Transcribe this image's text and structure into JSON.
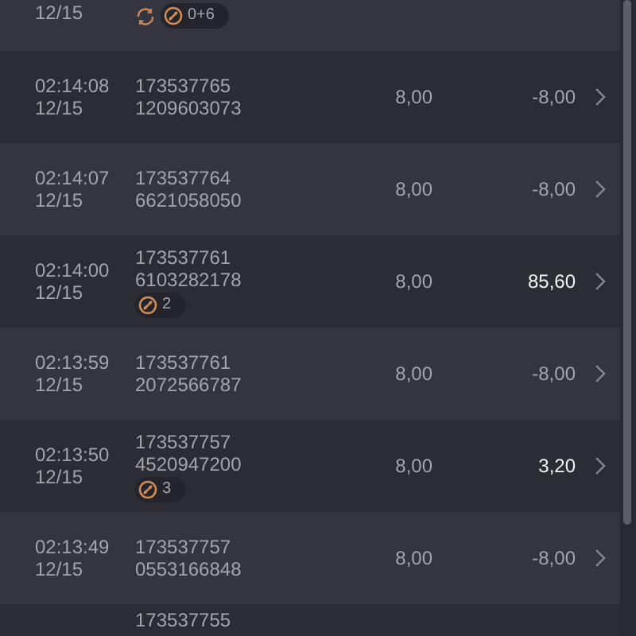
{
  "rows": [
    {
      "date": "12/15",
      "refresh": true,
      "badge": "0+6"
    },
    {
      "time": "02:14:08",
      "date": "12/15",
      "ids": [
        "173537765",
        "1209603073"
      ],
      "amount": "8,00",
      "result": "-8,00",
      "highlight": false
    },
    {
      "time": "02:14:07",
      "date": "12/15",
      "ids": [
        "173537764",
        "6621058050"
      ],
      "amount": "8,00",
      "result": "-8,00",
      "highlight": false
    },
    {
      "time": "02:14:00",
      "date": "12/15",
      "ids": [
        "173537761",
        "6103282178"
      ],
      "badge": "2",
      "amount": "8,00",
      "result": "85,60",
      "highlight": true
    },
    {
      "time": "02:13:59",
      "date": "12/15",
      "ids": [
        "173537761",
        "2072566787"
      ],
      "amount": "8,00",
      "result": "-8,00",
      "highlight": false
    },
    {
      "time": "02:13:50",
      "date": "12/15",
      "ids": [
        "173537757",
        "4520947200"
      ],
      "badge": "3",
      "amount": "8,00",
      "result": "3,20",
      "highlight": true
    },
    {
      "time": "02:13:49",
      "date": "12/15",
      "ids": [
        "173537757",
        "0553166848"
      ],
      "amount": "8,00",
      "result": "-8,00",
      "highlight": false
    },
    {
      "ids": [
        "173537755"
      ]
    }
  ]
}
